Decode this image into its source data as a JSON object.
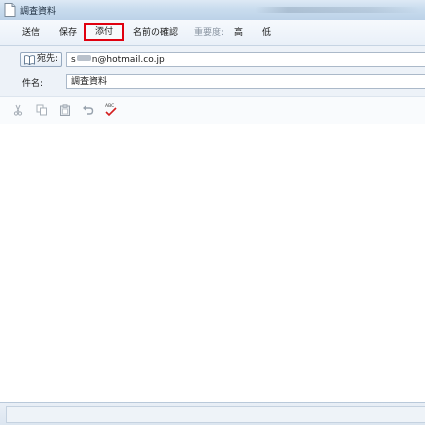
{
  "window": {
    "title": "調査資料"
  },
  "menu": {
    "send": "送信",
    "save": "保存",
    "attach": "添付",
    "check_names": "名前の確認",
    "importance_label": "重要度:",
    "high": "高",
    "low": "低"
  },
  "headers": {
    "to_button": "宛先:",
    "to_value_prefix": "s",
    "to_value_suffix": "n@hotmail.co.jp",
    "subject_label": "件名:",
    "subject_value": "調査資料"
  },
  "toolbar": {
    "icons": [
      "cut-icon",
      "copy-icon",
      "paste-icon",
      "undo-icon",
      "spellcheck-icon"
    ],
    "spellcheck_text": "ABC"
  },
  "colors": {
    "highlight": "#e0000f",
    "titlebar": "#c9dcee",
    "menubar": "#eef3f9"
  }
}
